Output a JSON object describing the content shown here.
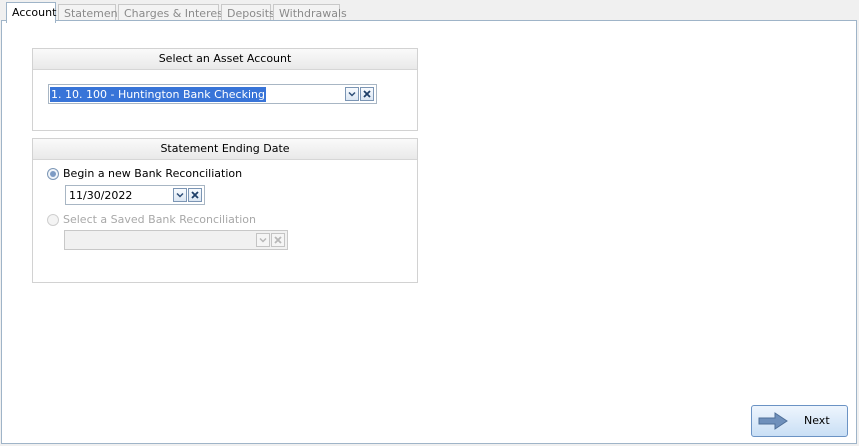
{
  "tabs": [
    {
      "label": "Account",
      "active": true
    },
    {
      "label": "Statement",
      "active": false
    },
    {
      "label": "Charges & Interest",
      "active": false
    },
    {
      "label": "Deposits",
      "active": false
    },
    {
      "label": "Withdrawals",
      "active": false
    }
  ],
  "asset_account": {
    "header": "Select an Asset Account",
    "selected_value": "1. 10. 100 - Huntington Bank Checking"
  },
  "statement_ending_date": {
    "header": "Statement Ending Date",
    "new_reconciliation_label": "Begin a new Bank Reconciliation",
    "new_reconciliation_checked": true,
    "ending_date_value": "11/30/2022",
    "saved_reconciliation_label": "Select a Saved Bank Reconciliation",
    "saved_reconciliation_enabled": false,
    "saved_reconciliation_value": ""
  },
  "footer": {
    "next_label": "Next"
  },
  "colors": {
    "accent": "#3874d8",
    "tab_border": "#9fb4c8",
    "button_gradient_bottom": "#c9dff5"
  },
  "icons": [
    "chevron-down-icon",
    "clear-x-icon",
    "arrow-right-icon"
  ]
}
